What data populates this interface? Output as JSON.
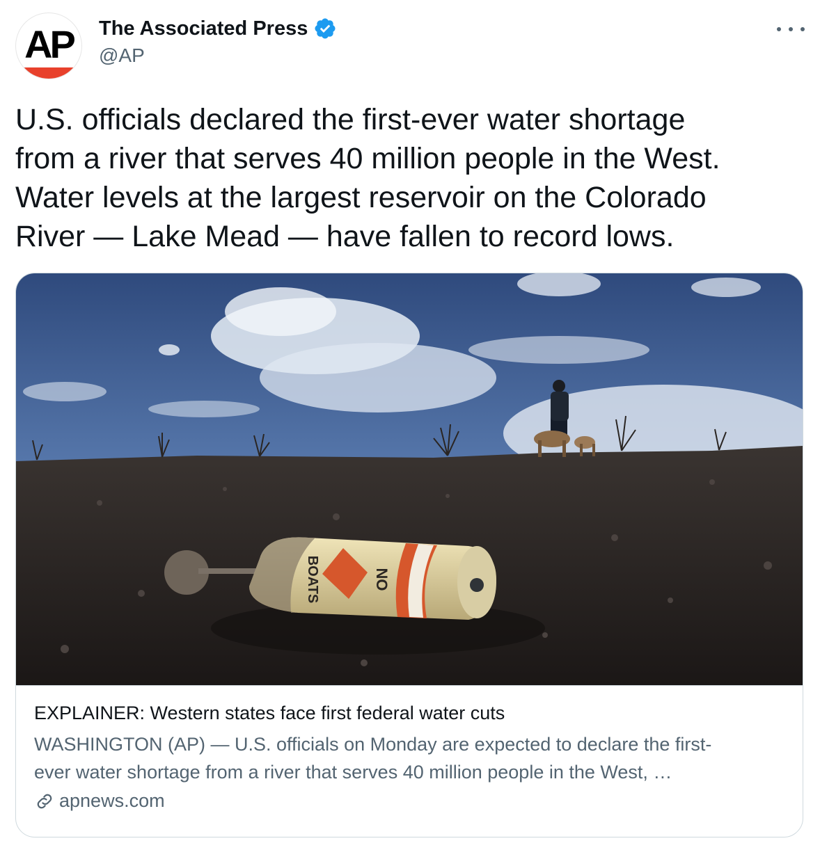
{
  "author": {
    "name": "The Associated Press",
    "handle": "@AP",
    "avatar_text": "AP",
    "verified_icon": "verified-badge-icon",
    "brand_color": "#e8412c",
    "verified_color": "#1d9bf0"
  },
  "menu": {
    "icon": "more-horizontal-icon"
  },
  "tweet": {
    "text": "U.S. officials declared the first-ever water shortage\nfrom a river that serves 40 million people in the West.\nWater levels at the largest reservoir on the Colorado\nRiver — Lake Mead — have fallen to record lows."
  },
  "card": {
    "image_sign_text": [
      "BOATS",
      "NO"
    ],
    "title": "EXPLAINER: Western states face first federal water cuts",
    "description": "WASHINGTON (AP) — U.S. officials on Monday are expected to declare the first-\never water shortage from a river that serves 40 million people in the West, …",
    "domain": "apnews.com",
    "link_icon": "link-icon"
  }
}
